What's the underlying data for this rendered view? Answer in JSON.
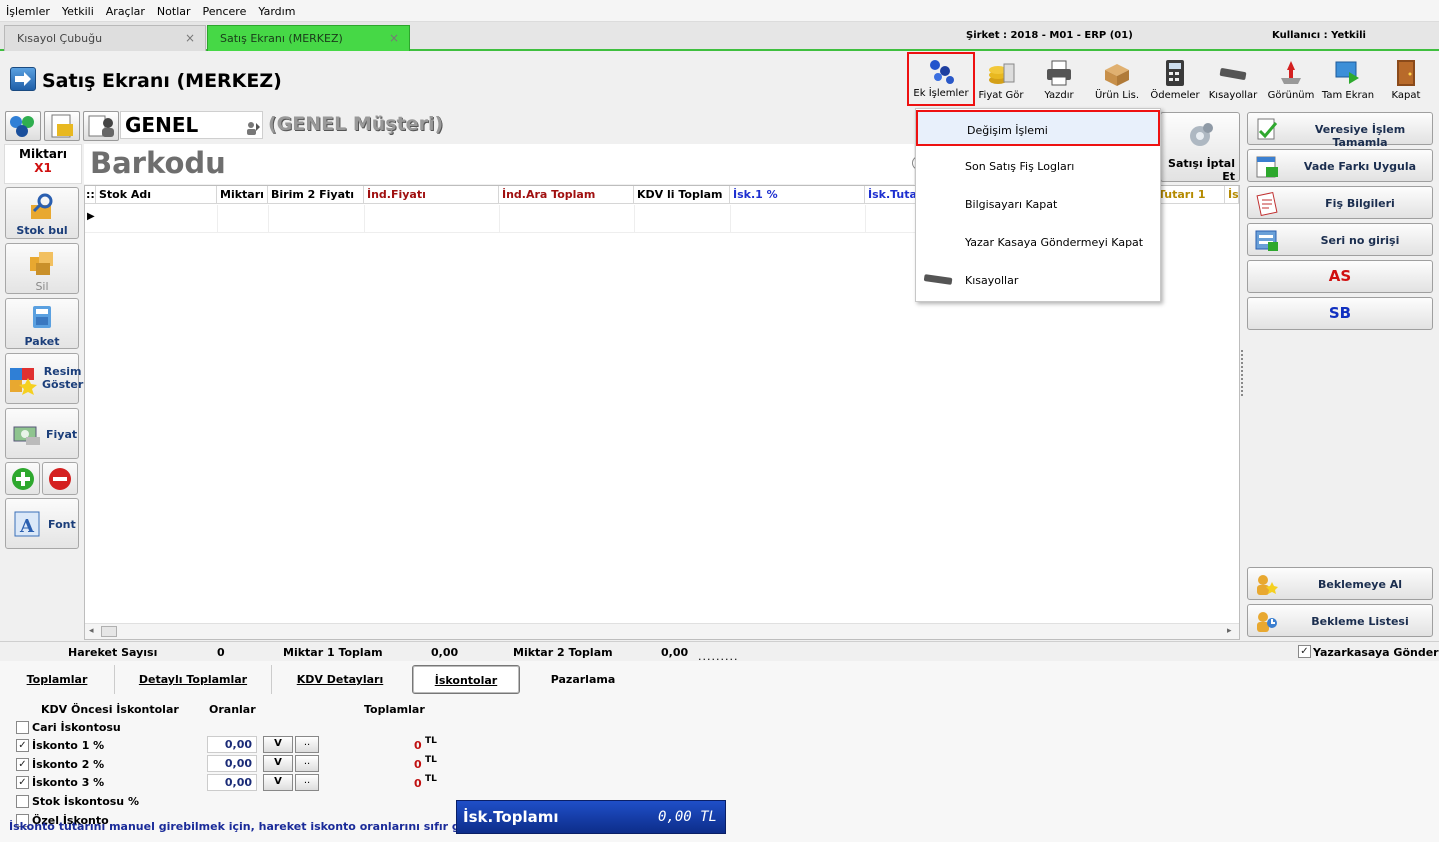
{
  "menu": [
    "İşlemler",
    "Yetkili",
    "Araçlar",
    "Notlar",
    "Pencere",
    "Yardım"
  ],
  "tabs": [
    {
      "label": "Kısayol Çubuğu",
      "active": false
    },
    {
      "label": "Satış Ekranı (MERKEZ)",
      "active": true
    }
  ],
  "tab_close_glyph": "×",
  "company_label": "Şirket : 2018 - M01 - ERP (01)",
  "user_label": "Kullanıcı : Yetkili",
  "page_title": "Satış Ekranı (MERKEZ)",
  "toolbar": [
    {
      "label": "Ek İşlemler",
      "icon": "gears-icon",
      "selected": true
    },
    {
      "label": "Fiyat Gör",
      "icon": "coins-icon"
    },
    {
      "label": "Yazdır",
      "icon": "printer-icon"
    },
    {
      "label": "Ürün Lis.",
      "icon": "box-list-icon"
    },
    {
      "label": "Ödemeler",
      "icon": "calculator-icon"
    },
    {
      "label": "Kısayollar",
      "icon": "keyboard-icon"
    },
    {
      "label": "Görünüm",
      "icon": "view-icon"
    },
    {
      "label": "Tam Ekran",
      "icon": "fullscreen-icon"
    },
    {
      "label": "Kapat",
      "icon": "door-exit-icon"
    }
  ],
  "customer": {
    "code": "GENEL",
    "name": "(GENEL Müşteri)"
  },
  "quantity": {
    "label": "Miktarı",
    "value": "X1"
  },
  "barcode_label": "Barkodu",
  "left_buttons": [
    {
      "label": "Stok bul",
      "icon": "search-stock-icon"
    },
    {
      "label": "Sil",
      "icon": "delete-stock-icon"
    },
    {
      "label": "Paket",
      "icon": "package-icon"
    },
    {
      "label": "Resim Göster",
      "icon": "image-icon"
    },
    {
      "label": "Fiyat",
      "icon": "price-icon"
    },
    {
      "label": "Font",
      "icon": "font-icon"
    }
  ],
  "grid": {
    "handle": "::",
    "row_marker": "▶",
    "columns": [
      {
        "label": "Stok Adı",
        "color": "#000000"
      },
      {
        "label": "Miktarı",
        "color": "#000000"
      },
      {
        "label": "Birim 2 Fiyatı",
        "color": "#000000"
      },
      {
        "label": "İnd.Fiyatı",
        "color": "#a01010"
      },
      {
        "label": "İnd.Ara Toplam",
        "color": "#a01010"
      },
      {
        "label": "KDV li Toplam",
        "color": "#000000"
      },
      {
        "label": "İsk.1 %",
        "color": "#1d2fd0"
      },
      {
        "label": "İsk.Tutarı",
        "color": "#1d2fd0"
      },
      {
        "label": "Tutarı 1",
        "color": "#b48a00"
      },
      {
        "label": "İs",
        "color": "#b48a00"
      }
    ]
  },
  "dropdown": [
    {
      "label": "Değişim İşlemi",
      "highlighted": true
    },
    {
      "label": "Son Satış Fiş Logları"
    },
    {
      "label": "Bilgisayarı Kapat"
    },
    {
      "label": "Yazar Kasaya Göndermeyi Kapat"
    },
    {
      "label": "Kısayollar",
      "icon": "keyboard-icon"
    }
  ],
  "cancel_sale_label": "Satışı İptal Et",
  "right_buttons": [
    {
      "label": "Veresiye İşlem Tamamla",
      "icon": "check-document-icon"
    },
    {
      "label": "Vade Farkı Uygula",
      "icon": "calendar-icon"
    },
    {
      "label": "Fiş Bilgileri",
      "icon": "receipt-icon"
    },
    {
      "label": "Seri no girişi",
      "icon": "serial-icon"
    },
    {
      "label": "AS",
      "color": "#d01010"
    },
    {
      "label": "SB",
      "color": "#1030c0"
    }
  ],
  "waiting_buttons": [
    {
      "label": "Beklemeye Al",
      "icon": "users-wait-icon"
    },
    {
      "label": "Bekleme Listesi",
      "icon": "users-list-icon"
    }
  ],
  "status": {
    "move_count_label": "Hareket Sayısı",
    "move_count": "0",
    "qty1_label": "Miktar 1 Toplam",
    "qty1": "0,00",
    "qty2_label": "Miktar 2 Toplam",
    "qty2": "0,00",
    "drag_hint": "........."
  },
  "send_register": {
    "label": "Yazarkasaya Gönder",
    "checked": true
  },
  "bottom_tabs": [
    {
      "label": "Toplamlar"
    },
    {
      "label": "Detaylı Toplamlar"
    },
    {
      "label": "KDV Detayları"
    },
    {
      "label": "İskontolar",
      "active": true
    },
    {
      "label": "Pazarlama"
    }
  ],
  "discounts": {
    "header_pre": "KDV Öncesi İskontolar",
    "header_rates": "Oranlar",
    "header_totals": "Toplamlar",
    "cari": {
      "label": "Cari İskontosu",
      "checked": false
    },
    "rows": [
      {
        "label": "İskonto 1 %",
        "checked": true,
        "value": "0,00",
        "total": "0",
        "currency": "TL"
      },
      {
        "label": "İskonto 2 %",
        "checked": true,
        "value": "0,00",
        "total": "0",
        "currency": "TL"
      },
      {
        "label": "İskonto 3 %",
        "checked": true,
        "value": "0,00",
        "total": "0",
        "currency": "TL"
      }
    ],
    "v_label": "V",
    "dots_label": "..",
    "stock": {
      "label": "Stok İskontosu %",
      "checked": false
    },
    "special": {
      "label": "Özel İskonto",
      "checked": false
    },
    "note": "İskonto tutarını manuel girebilmek için, hareket iskonto oranlarını sıfır giriniz."
  },
  "discount_total": {
    "label": "İsk.Toplamı",
    "value": "0,00 TL"
  }
}
